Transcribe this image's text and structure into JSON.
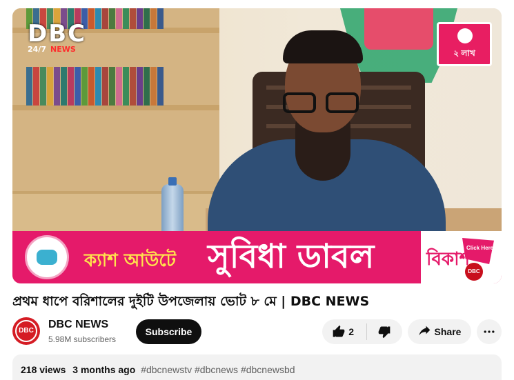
{
  "video": {
    "watermark": {
      "brand": "DBC",
      "sub1": "24/7",
      "sub2": "NEWS"
    },
    "corner_logo_text": "২ লাখ",
    "banner": {
      "small_text": "ক্যাশ আউটে",
      "big_text": "সুবিধা ডাবল",
      "brand": "বিকাশ",
      "click_label": "Click Here",
      "mini_logo": "DBC"
    }
  },
  "title": "প্রথম ধাপে বরিশালের দুইটি উপজেলায় ভোট ৮ মে | DBC NEWS",
  "channel": {
    "avatar_text": "DBC",
    "name": "DBC NEWS",
    "subscribers": "5.98M subscribers",
    "subscribe_label": "Subscribe"
  },
  "actions": {
    "like_count": "2",
    "share_label": "Share"
  },
  "description": {
    "views": "218 views",
    "age": "3 months ago",
    "tags": "#dbcnewstv #dbcnews #dbcnewsbd"
  },
  "icons": [
    "like-icon",
    "dislike-icon",
    "share-icon",
    "more-icon"
  ]
}
